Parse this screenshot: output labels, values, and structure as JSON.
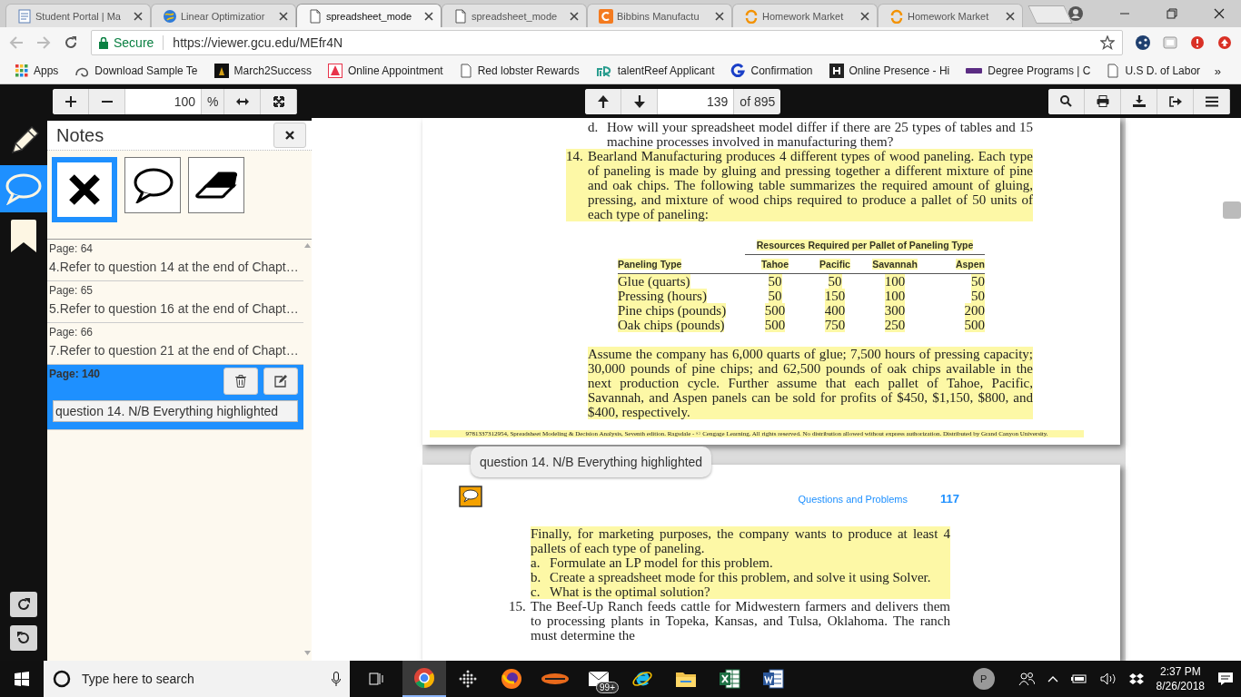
{
  "browser": {
    "tabs": [
      {
        "title": "Student Portal | Ma",
        "kind": "portal",
        "selected": false
      },
      {
        "title": "Linear Optimizatior",
        "kind": "globe",
        "selected": false
      },
      {
        "title": "spreadsheet_mode",
        "kind": "doc",
        "selected": true
      },
      {
        "title": "spreadsheet_mode",
        "kind": "doc",
        "selected": false
      },
      {
        "title": "Bibbins Manufactu",
        "kind": "cengage",
        "selected": false
      },
      {
        "title": "Homework Market",
        "kind": "homework",
        "selected": false
      },
      {
        "title": "Homework Market",
        "kind": "homework",
        "selected": false
      }
    ],
    "secure_label": "Secure",
    "url": "https://viewer.gcu.edu/MEfr4N",
    "bookmarks": [
      {
        "label": "Apps",
        "kind": "apps"
      },
      {
        "label": "Download Sample Te",
        "kind": "swirl"
      },
      {
        "label": "March2Success",
        "kind": "square"
      },
      {
        "label": "Online Appointment",
        "kind": "triangle"
      },
      {
        "label": "Red lobster Rewards",
        "kind": "doc"
      },
      {
        "label": "talentReef Applicant",
        "kind": "leaf"
      },
      {
        "label": "Confirmation",
        "kind": "g"
      },
      {
        "label": "Online Presence - Hi",
        "kind": "h"
      },
      {
        "label": "Degree Programs | C",
        "kind": "band"
      },
      {
        "label": "U.S D. of Labor",
        "kind": "doc"
      }
    ],
    "more": "»"
  },
  "toolbar": {
    "zoom": "100",
    "zoom_unit": "%",
    "page": "139",
    "page_total": "of 895"
  },
  "rail": {
    "items": [
      {
        "kind": "pencil",
        "selected": false
      },
      {
        "kind": "comment",
        "selected": true
      },
      {
        "kind": "bookmark",
        "selected": false
      }
    ]
  },
  "notes": {
    "title": "Notes",
    "tools": [
      {
        "kind": "cancel",
        "selected": true
      },
      {
        "kind": "comment",
        "selected": false
      },
      {
        "kind": "eraser",
        "selected": false
      }
    ],
    "items": [
      {
        "page": "Page: 64",
        "text": "4.Refer to question 14 at the end of Chapt…",
        "selected": false
      },
      {
        "page": "Page: 65",
        "text": "5.Refer to question 16 at the end of Chapt…",
        "selected": false
      },
      {
        "page": "Page: 66",
        "text": "7.Refer to question 21 at the end of Chapt…",
        "selected": false
      },
      {
        "page": "Page: 140",
        "text": "question 14. N/B Everything highlighted",
        "selected": true
      }
    ]
  },
  "document": {
    "page_a": {
      "items": [
        {
          "kind": "subitem",
          "label": "d.",
          "text": "How will your spreadsheet model differ if there are 25 types of tables and 15 machine processes involved in manufacturing them?",
          "highlighted": false
        },
        {
          "kind": "problem",
          "label": "14.",
          "text": "Bearland Manufacturing produces 4 different types of wood paneling. Each type of paneling is made by gluing and pressing together a different mixture of pine and oak chips. The following table summarizes the required amount of gluing, pressing, and mixture of wood chips required to produce a pallet of 50 units of each type of paneling:",
          "highlighted": true
        },
        {
          "kind": "table",
          "highlighted": true,
          "group_header": "Resources Required per Pallet of Paneling Type",
          "columns": [
            "Paneling Type",
            "Tahoe",
            "Pacific",
            "Savannah",
            "Aspen"
          ],
          "rows": [
            [
              "Glue (quarts)",
              "50",
              "50",
              "100",
              "50"
            ],
            [
              "Pressing (hours)",
              "50",
              "150",
              "100",
              "50"
            ],
            [
              "Pine chips (pounds)",
              "500",
              "400",
              "300",
              "200"
            ],
            [
              "Oak chips (pounds)",
              "500",
              "750",
              "250",
              "500"
            ]
          ]
        },
        {
          "kind": "continuation",
          "text": "Assume the company has 6,000 quarts of glue; 7,500 hours of pressing capacity; 30,000 pounds of pine chips; and 62,500 pounds of oak chips available in the next production cycle. Further assume that each pallet of Tahoe, Pacific, Savannah, and Aspen panels can be sold for profits of $450, $1,150, $800, and $400, respectively.",
          "highlighted": true
        }
      ],
      "footer": {
        "text": "9781337312954, Spreadsheet Modeling & Decision Analysis, Seventh edition. Ragsdale - © Cengage Learning. All rights reserved. No distribution allowed without express authorization. Distributed by Grand Canyon University.",
        "highlighted": true
      }
    },
    "comment": {
      "text": "question 14. N/B Everything highlighted"
    },
    "page_b": {
      "running_head": "Questions and Problems",
      "page_number": "117",
      "items": [
        {
          "kind": "continuation",
          "text": "Finally, for marketing purposes, the company wants to produce at least 4 pallets of each type of paneling.",
          "highlighted": true
        },
        {
          "kind": "subitem",
          "label": "a.",
          "text": "Formulate an LP model for this problem.",
          "highlighted": true
        },
        {
          "kind": "subitem",
          "label": "b.",
          "text": "Create a spreadsheet mode for this problem, and solve it using Solver.",
          "highlighted": true
        },
        {
          "kind": "subitem",
          "label": "c.",
          "text": "What is the optimal solution?",
          "highlighted": true
        },
        {
          "kind": "problem",
          "label": "15.",
          "text": "The Beef-Up Ranch feeds cattle for Midwestern farmers and delivers them to processing plants in Topeka, Kansas, and Tulsa, Oklahoma. The ranch must determine the",
          "highlighted": false
        }
      ]
    }
  },
  "taskbar": {
    "search_placeholder": "Type here to search",
    "apps": [
      {
        "kind": "chrome",
        "selected": true
      },
      {
        "kind": "dots",
        "selected": false
      },
      {
        "kind": "firefox",
        "selected": false
      },
      {
        "kind": "flame",
        "selected": false
      },
      {
        "kind": "mail",
        "selected": false,
        "badge": "99+"
      },
      {
        "kind": "ie",
        "selected": false
      },
      {
        "kind": "folder",
        "selected": false
      },
      {
        "kind": "excel",
        "selected": false
      },
      {
        "kind": "word",
        "selected": false
      }
    ],
    "avatar": "P",
    "time": "2:37 PM",
    "date": "8/26/2018"
  }
}
